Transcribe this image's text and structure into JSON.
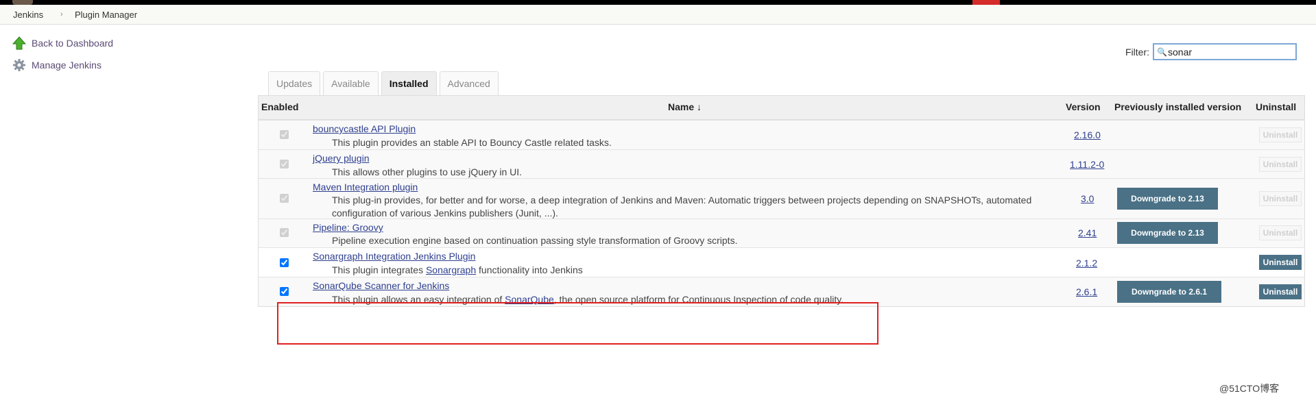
{
  "breadcrumb": {
    "root": "Jenkins",
    "separator": "›",
    "current": "Plugin Manager"
  },
  "sidebar": {
    "items": [
      {
        "label": "Back to Dashboard",
        "icon": "up-arrow-icon"
      },
      {
        "label": "Manage Jenkins",
        "icon": "gear-icon"
      }
    ]
  },
  "filter": {
    "label": "Filter:",
    "value": "sonar"
  },
  "tabs": [
    {
      "label": "Updates",
      "active": false
    },
    {
      "label": "Available",
      "active": false
    },
    {
      "label": "Installed",
      "active": true
    },
    {
      "label": "Advanced",
      "active": false
    }
  ],
  "table": {
    "headers": {
      "enabled": "Enabled",
      "name": "Name ↓",
      "version": "Version",
      "previous": "Previously installed version",
      "uninstall": "Uninstall"
    },
    "rows": [
      {
        "name": "bouncycastle API Plugin",
        "desc": "This plugin provides an stable API to Bouncy Castle related tasks.",
        "version": "2.16.0",
        "downgrade": null,
        "uninstall": "Uninstall",
        "uninstall_enabled": false,
        "checked": true,
        "checkbox_disabled": true
      },
      {
        "name": "jQuery plugin",
        "desc": "This allows other plugins to use jQuery in UI.",
        "version": "1.11.2-0",
        "downgrade": null,
        "uninstall": "Uninstall",
        "uninstall_enabled": false,
        "checked": true,
        "checkbox_disabled": true
      },
      {
        "name": "Maven Integration plugin",
        "desc_line1": "This plug-in provides, for better and for worse, a deep integration of Jenkins and Maven: Automatic triggers between projects depending on SNAPSHOTs, automated",
        "desc_line2": "configuration of various Jenkins publishers (Junit, ...).",
        "version": "3.0",
        "downgrade": "Downgrade to 2.13",
        "uninstall": "Uninstall",
        "uninstall_enabled": false,
        "checked": true,
        "checkbox_disabled": true
      },
      {
        "name": "Pipeline: Groovy",
        "desc": "Pipeline execution engine based on continuation passing style transformation of Groovy scripts.",
        "version": "2.41",
        "downgrade": "Downgrade to 2.13",
        "uninstall": "Uninstall",
        "uninstall_enabled": false,
        "checked": true,
        "checkbox_disabled": true
      },
      {
        "name": "Sonargraph Integration Jenkins Plugin",
        "desc_pre": "This plugin integrates ",
        "desc_link": "Sonargraph",
        "desc_post": " functionality into Jenkins",
        "version": "2.1.2",
        "downgrade": null,
        "uninstall": "Uninstall",
        "uninstall_enabled": true,
        "checked": true,
        "checkbox_disabled": false
      },
      {
        "name": "SonarQube Scanner for Jenkins",
        "desc_pre": "This plugin allows an easy integration of ",
        "desc_link": "SonarQube",
        "desc_post": ", the open source platform for Continuous Inspection of code quality.",
        "version": "2.6.1",
        "downgrade": "Downgrade to 2.6.1",
        "uninstall": "Uninstall",
        "uninstall_enabled": true,
        "checked": true,
        "checkbox_disabled": false
      }
    ]
  },
  "watermark": "@51CTO博客",
  "colors": {
    "accent": "#4a7186",
    "link": "#2e3f8f",
    "highlight": "#e02020"
  }
}
